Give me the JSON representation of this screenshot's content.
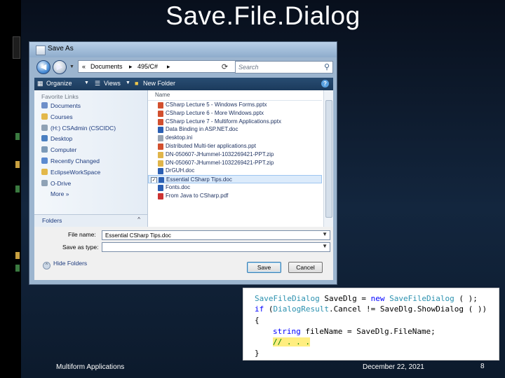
{
  "slide": {
    "title": "Save.File.Dialog",
    "footer_left": "Multiform Applications",
    "footer_center": "December 22, 2021",
    "page_number": "8"
  },
  "dialog": {
    "window_title": "Save As",
    "back_icon": "back-arrow-icon",
    "forward_icon": "forward-arrow-icon",
    "address": {
      "prefix": "«",
      "segments": [
        "Documents",
        "495/C#"
      ],
      "separator": "▸"
    },
    "refresh_icon": "refresh-icon",
    "search_placeholder": "Search",
    "toolbar": {
      "organize": "Organize",
      "views": "Views",
      "new_folder": "New Folder",
      "help": "?"
    },
    "favorites_header": "Favorite Links",
    "favorites": [
      {
        "label": "Documents",
        "color": "#6d8fc9"
      },
      {
        "label": "Courses",
        "color": "#e3b84a"
      },
      {
        "label": "(H:) CSAdmin (CSCIDC)",
        "color": "#8fa2b5"
      },
      {
        "label": "Desktop",
        "color": "#4a7fc1"
      },
      {
        "label": "Computer",
        "color": "#7c9ab8"
      },
      {
        "label": "Recently Changed",
        "color": "#5b8ad0"
      },
      {
        "label": "EclipseWorkSpace",
        "color": "#e3b84a"
      },
      {
        "label": "O-Drive",
        "color": "#8fa2b5"
      },
      {
        "label": "More »",
        "color": ""
      }
    ],
    "folders_label": "Folders",
    "folders_chevron": "^",
    "name_header": "Name",
    "files": [
      {
        "name": "CSharp Lecture 5 - Windows Forms.pptx",
        "color": "#d2502f"
      },
      {
        "name": "CSharp Lecture 6 - More Windows.pptx",
        "color": "#d2502f"
      },
      {
        "name": "CSharp Lecture 7 - Multiform Applications.pptx",
        "color": "#d2502f"
      },
      {
        "name": "Data Binding in ASP.NET.doc",
        "color": "#2b5fb3"
      },
      {
        "name": "desktop.ini",
        "color": "#9aa5b3"
      },
      {
        "name": "Distributed Multi-tier applications.ppt",
        "color": "#d2502f"
      },
      {
        "name": "DN-050607-JHummel-1032269421-PPT.zip",
        "color": "#e0b54a"
      },
      {
        "name": "DN-050607-JHummel-1032269421-PPT.zip",
        "color": "#e0b54a"
      },
      {
        "name": "DrGUH.doc",
        "color": "#2b5fb3"
      },
      {
        "name": "Essential CSharp Tips.doc",
        "color": "#2b5fb3"
      },
      {
        "name": "Fonts.doc",
        "color": "#2b5fb3"
      },
      {
        "name": "From Java to CSharp.pdf",
        "color": "#c33"
      }
    ],
    "selected_index": 9,
    "file_name_label": "File name:",
    "file_name_value": "Essential CSharp Tips.doc",
    "save_type_label": "Save as type:",
    "save_type_value": "",
    "hide_folders": "Hide Folders",
    "save_button": "Save",
    "cancel_button": "Cancel"
  },
  "code": {
    "line1": {
      "a": "SaveFileDialog",
      "b": " SaveDlg = ",
      "c": "new",
      "d": " ",
      "e": "SaveFileDialog",
      "f": " ( );"
    },
    "line2": {
      "a": "if",
      "b": " (",
      "c": "DialogResult",
      "d": ".Cancel != SaveDlg.ShowDialog ( ))"
    },
    "line3": "{",
    "line4": {
      "a": "string",
      "b": " fileName = SaveDlg.FileName;"
    },
    "line5": "// . . .",
    "line6": "}"
  }
}
